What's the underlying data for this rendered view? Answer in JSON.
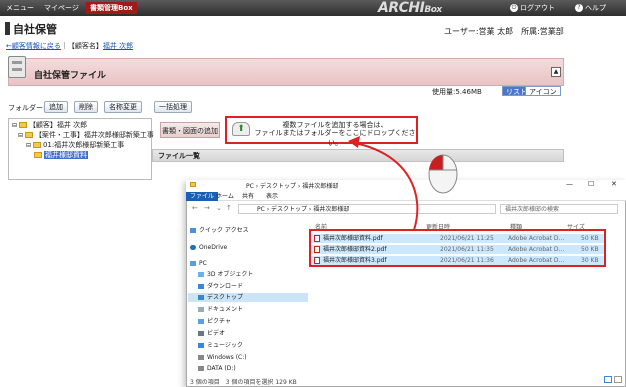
{
  "topnav": {
    "menu": "メニュー",
    "mypage": "マイページ",
    "active": "書類管理Box"
  },
  "brand": {
    "logo_main": "ARCHI",
    "logo_box": "Box"
  },
  "top_right": {
    "logout": "ログアウト",
    "help": "ヘルプ"
  },
  "page": {
    "title": "自社保管",
    "back_link": "←顧客情報に戻る",
    "client_label": "｜【顧客名】",
    "client_name": "福井 次郎",
    "user_info": "ユーザー:営業 太郎　所属:営業部"
  },
  "panel": {
    "title": "自社保管ファイル",
    "collapse": "▲",
    "usage": "使用量:5.46MB",
    "view_list": "リスト",
    "view_icon": "アイコン"
  },
  "toolbar": {
    "folder_label": "フォルダー:",
    "add": "追加",
    "delete": "削除",
    "rename": "名称変更",
    "bulk": "一括処理"
  },
  "tree": [
    "【顧客】福井 次郎",
    "【案件・工事】福井次郎様邸新築工事",
    "01:福井次郎様邸新築工事",
    "福井様邸資料"
  ],
  "tabs": {
    "docs": "書類・図面の追加"
  },
  "drop": {
    "line1": "複数ファイルを追加する場合は、",
    "line2": "ファイルまたはフォルダーをここにドロップください。"
  },
  "filelist": {
    "header": "ファイル一覧"
  },
  "explorer": {
    "ribbon": [
      "ファイル",
      "ホーム",
      "共有",
      "表示"
    ],
    "address": "PC › デスクトップ › 福井次郎様邸",
    "search_placeholder": "福井次郎様邸の検索",
    "sidebar": [
      "クイック アクセス",
      "OneDrive",
      "PC",
      "3D オブジェクト",
      "ダウンロード",
      "デスクトップ",
      "ドキュメント",
      "ピクチャ",
      "ビデオ",
      "ミュージック",
      "Windows (C:)",
      "DATA (D:)"
    ],
    "columns": {
      "name": "名前",
      "date": "更新日時",
      "type": "種類",
      "size": "サイズ"
    },
    "files": [
      {
        "name": "福井次郎様邸資料.pdf",
        "date": "2021/06/21 11:25",
        "type": "Adobe Acrobat D...",
        "size": "50 KB"
      },
      {
        "name": "福井次郎様邸資料2.pdf",
        "date": "2021/06/21 11:35",
        "type": "Adobe Acrobat D...",
        "size": "50 KB"
      },
      {
        "name": "福井次郎様邸資料3.pdf",
        "date": "2021/06/21 11:36",
        "type": "Adobe Acrobat D...",
        "size": "30 KB"
      }
    ],
    "status": "3 個の項目　3 個の項目を選択 129 KB"
  },
  "colors": {
    "accent_red": "#d22222",
    "nav_active": "#a11a1a",
    "panel_pink": "#efd3d4",
    "selected_blue": "#cce8ff"
  }
}
